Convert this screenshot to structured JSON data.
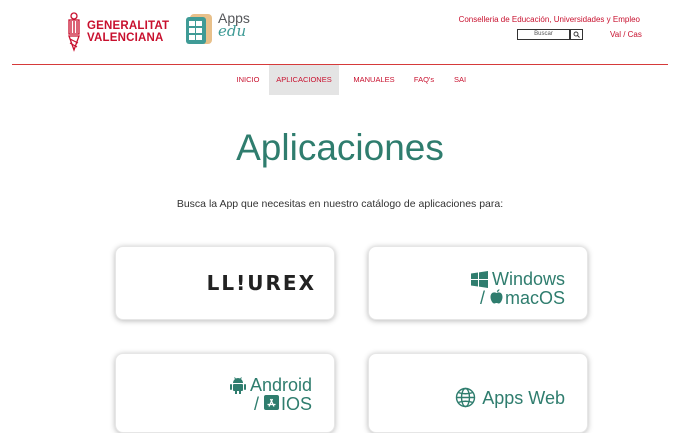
{
  "header": {
    "gv_logo": {
      "line1": "GENERALITAT",
      "line2": "VALENCIANA"
    },
    "apps_logo": {
      "line1": "Apps",
      "line2": "edu"
    },
    "ministry": "Conselleria de Educación, Universidades y Empleo",
    "search": {
      "placeholder": "Buscar"
    },
    "language": "Val / Cas"
  },
  "nav": {
    "items": [
      {
        "label": "INICIO",
        "active": false
      },
      {
        "label": "APLICACIONES",
        "active": true
      },
      {
        "label": "MANUALES",
        "active": false
      },
      {
        "label": "FAQ's",
        "active": false
      },
      {
        "label": "SAI",
        "active": false
      }
    ]
  },
  "main": {
    "title": "Aplicaciones",
    "subtitle": "Busca la App que necesitas en nuestro catálogo de aplicaciones para:",
    "cards": [
      {
        "label": "LL!UREX"
      },
      {
        "line1": "Windows",
        "line2": "/ macOS",
        "icons": [
          "windows-icon",
          "apple-icon"
        ]
      },
      {
        "line1": "Android",
        "line2": "/ IOS",
        "icons": [
          "android-icon",
          "app-store-icon"
        ]
      },
      {
        "label": "Apps Web",
        "icons": [
          "globe-icon"
        ]
      }
    ]
  },
  "colors": {
    "brand_red": "#c8102e",
    "accent_green": "#2f7d6e",
    "nav_active_bg": "#e4e4e4"
  }
}
